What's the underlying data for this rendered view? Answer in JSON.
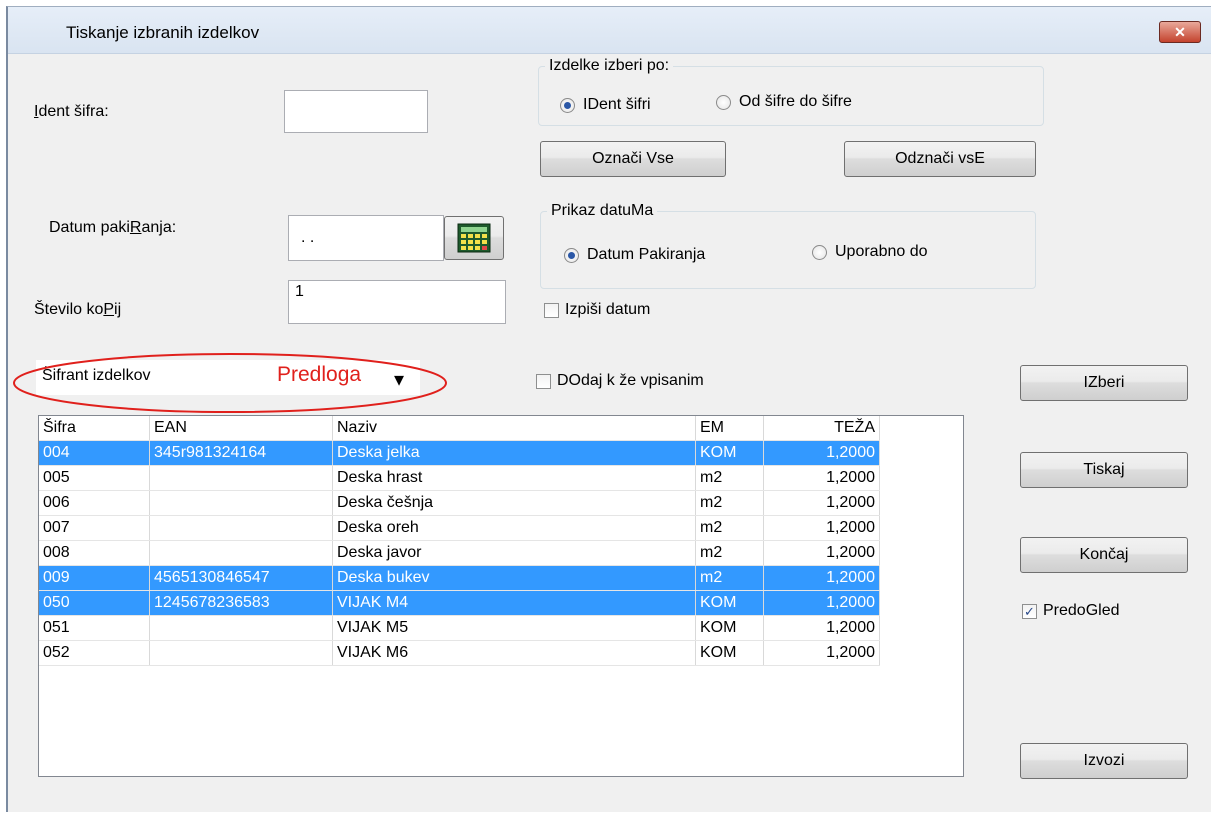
{
  "window": {
    "title": "Tiskanje izbranih izdelkov",
    "close_label": "✕"
  },
  "ident": {
    "label_pre": "",
    "label_u": "I",
    "label_post": "dent šifra:",
    "value": ""
  },
  "datum": {
    "label_pre": "Datum paki",
    "label_u": "R",
    "label_post": "anja:",
    "value": ". ."
  },
  "kopij": {
    "label_pre": "Število ko",
    "label_u": "P",
    "label_post": "ij",
    "value": "1"
  },
  "izbor": {
    "title": "Izdelke izberi po:",
    "opt1": "IDent šifri",
    "opt2": "Od šifre do šifre",
    "selected": 1
  },
  "prikaz": {
    "title": "Prikaz datuMa",
    "opt1": "Datum Pakiranja",
    "opt2": "Uporabno do",
    "selected": 1
  },
  "buttons": {
    "oznaci": "Označi Vse",
    "odznaci": "Odznači vsE",
    "izberi": "IZberi",
    "tiskaj": "Tiskaj",
    "koncaj": "Končaj",
    "izvozi": "Izvozi"
  },
  "checks": {
    "izpisi_datum": {
      "label": "Izpiši datum",
      "checked": false
    },
    "dodaj": {
      "label": "DOdaj k že vpisanim",
      "checked": false
    },
    "predogled": {
      "label": "PredoGled",
      "checked": true
    }
  },
  "combo": {
    "value": "Šifrant izdelkov",
    "annotation": "Predloga",
    "arrow": "▾"
  },
  "table": {
    "columns": [
      "Šifra",
      "EAN",
      "Naziv",
      "EM",
      "TEŽA"
    ],
    "rows": [
      {
        "sifra": "004",
        "ean": "345r981324164",
        "naziv": "Deska jelka",
        "em": "KOM",
        "teza": "1,2000",
        "selected": true
      },
      {
        "sifra": "005",
        "ean": "",
        "naziv": "Deska hrast",
        "em": "m2",
        "teza": "1,2000",
        "selected": false
      },
      {
        "sifra": "006",
        "ean": "",
        "naziv": "Deska češnja",
        "em": "m2",
        "teza": "1,2000",
        "selected": false
      },
      {
        "sifra": "007",
        "ean": "",
        "naziv": "Deska oreh",
        "em": "m2",
        "teza": "1,2000",
        "selected": false
      },
      {
        "sifra": "008",
        "ean": "",
        "naziv": "Deska javor",
        "em": "m2",
        "teza": "1,2000",
        "selected": false
      },
      {
        "sifra": "009",
        "ean": "4565130846547",
        "naziv": "Deska bukev",
        "em": "m2",
        "teza": "1,2000",
        "selected": true
      },
      {
        "sifra": "050",
        "ean": "1245678236583",
        "naziv": "VIJAK M4",
        "em": "KOM",
        "teza": "1,2000",
        "selected": true
      },
      {
        "sifra": "051",
        "ean": "",
        "naziv": "VIJAK M5",
        "em": "KOM",
        "teza": "1,2000",
        "selected": false
      },
      {
        "sifra": "052",
        "ean": "",
        "naziv": "VIJAK M6",
        "em": "KOM",
        "teza": "1,2000",
        "selected": false
      }
    ]
  },
  "colors": {
    "selection": "#3399ff",
    "annotation": "#e0201c"
  }
}
